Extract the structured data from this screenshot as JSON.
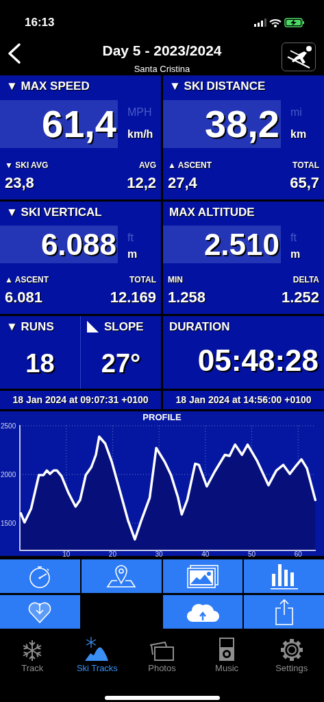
{
  "status_bar": {
    "time": "16:13"
  },
  "header": {
    "title": "Day 5 - 2023/2024",
    "subtitle": "Santa Cristina"
  },
  "panels": [
    {
      "title": "▼ MAX SPEED",
      "value": "61,4",
      "unit_alt": "MPH",
      "unit": "km/h",
      "left_label": "▼ SKI AVG",
      "left_value": "23,8",
      "right_label": "AVG",
      "right_value": "12,2"
    },
    {
      "title": "▼ SKI DISTANCE",
      "value": "38,2",
      "unit_alt": "mi",
      "unit": "km",
      "left_label": "▲ ASCENT",
      "left_value": "27,4",
      "right_label": "TOTAL",
      "right_value": "65,7"
    },
    {
      "title": "▼ SKI VERTICAL",
      "value": "6.088",
      "unit_alt": "ft",
      "unit": "m",
      "left_label": "▲ ASCENT",
      "left_value": "6.081",
      "right_label": "TOTAL",
      "right_value": "12.169"
    },
    {
      "title": "MAX ALTITUDE",
      "value": "2.510",
      "unit_alt": "ft",
      "unit": "m",
      "left_label": "MIN",
      "left_value": "1.258",
      "right_label": "DELTA",
      "right_value": "1.252"
    }
  ],
  "runs": {
    "title": "▼ RUNS",
    "value": "18"
  },
  "slope": {
    "title": "SLOPE",
    "value": "27°"
  },
  "duration": {
    "title": "DURATION",
    "value": "05:48:28"
  },
  "start_time": "18 Jan 2024 at 09:07:31 +0100",
  "end_time": "18 Jan 2024 at 14:56:00 +0100",
  "profile": {
    "chart_data": {
      "type": "area",
      "title": "PROFILE",
      "grid": true,
      "xlim": [
        0,
        63.8
      ],
      "ylim": [
        1220,
        2500
      ],
      "xticks": [
        10,
        20,
        30,
        40,
        50,
        60
      ],
      "yticks": [
        1500,
        2000,
        2500
      ],
      "x": [
        0.2,
        1.0,
        2.4,
        4.1,
        5.1,
        5.8,
        6.5,
        7.3,
        8.0,
        9.0,
        10.5,
        12.0,
        13.0,
        14.2,
        15.4,
        16.4,
        17.1,
        18.4,
        19.8,
        21.3,
        23.3,
        24.8,
        26.2,
        28.0,
        29.4,
        31.2,
        32.6,
        34.1,
        34.9,
        36.1,
        37.8,
        38.6,
        40.3,
        42.0,
        44.2,
        45.2,
        46.4,
        47.9,
        49.1,
        51.1,
        53.6,
        55.3,
        56.8,
        58.2,
        59.5,
        60.7,
        61.9,
        63.7
      ],
      "series": [
        {
          "color": "#ffffff",
          "values": [
            1600,
            1507,
            1646,
            1993,
            1993,
            2040,
            2005,
            2040,
            2040,
            1981,
            1808,
            1669,
            1738,
            1993,
            2074,
            2201,
            2387,
            2317,
            2132,
            1877,
            1530,
            1333,
            1530,
            1762,
            2271,
            2132,
            1993,
            1762,
            1588,
            1738,
            2109,
            2097,
            1877,
            2028,
            2201,
            2190,
            2306,
            2201,
            2306,
            2144,
            1889,
            2040,
            2097,
            2005,
            2086,
            2155,
            2063,
            1738
          ]
        }
      ]
    }
  },
  "actions": [
    {
      "kind": "stopwatch"
    },
    {
      "kind": "map"
    },
    {
      "kind": "photos"
    },
    {
      "kind": "stats"
    },
    {
      "kind": "favorite"
    },
    {
      "kind": "blank"
    },
    {
      "kind": "cloud"
    },
    {
      "kind": "share"
    }
  ],
  "tabs": [
    {
      "label": "Track",
      "kind": "snowflake",
      "selected": false
    },
    {
      "label": "Ski Tracks",
      "kind": "mountain",
      "selected": true
    },
    {
      "label": "Photos",
      "kind": "photos",
      "selected": false
    },
    {
      "label": "Music",
      "kind": "player",
      "selected": false
    },
    {
      "label": "Settings",
      "kind": "gear",
      "selected": false
    }
  ]
}
